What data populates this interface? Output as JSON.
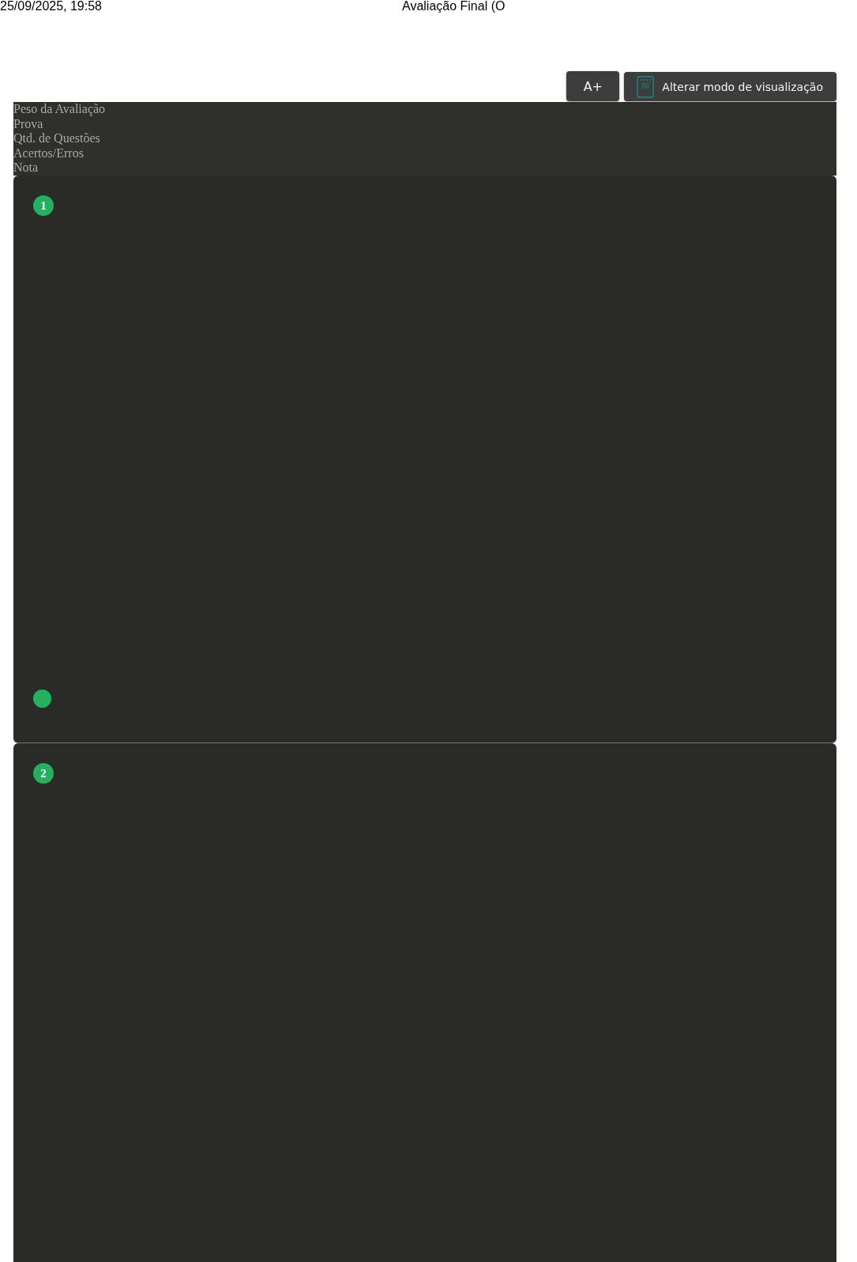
{
  "header": {
    "date": "25/09/2025, 19:58",
    "title": "Avaliação Final (O"
  },
  "toolbar": {
    "font_button": "A+",
    "view_button": "Alterar modo de visualização"
  },
  "summary_labels": [
    "Peso da Avaliação",
    "Prova",
    "Qtd. de Questões",
    "Acertos/Erros",
    "Nota"
  ],
  "questions": [
    {
      "number": "1",
      "footer_dot": true
    },
    {
      "number": "2"
    }
  ]
}
